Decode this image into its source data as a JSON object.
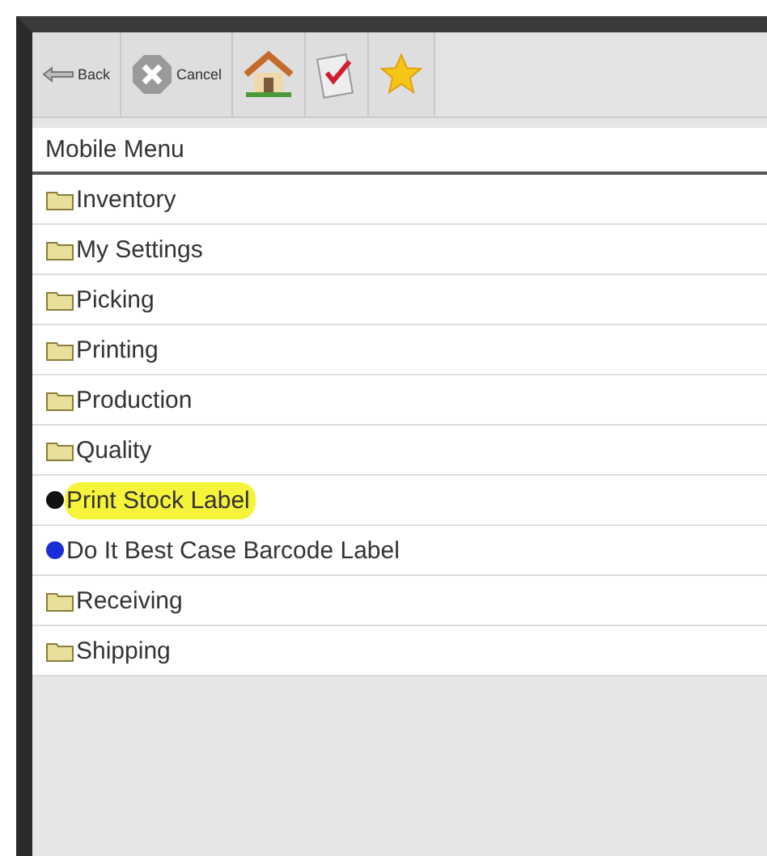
{
  "toolbar": [
    {
      "kind": "back",
      "label": "Back"
    },
    {
      "kind": "cancel",
      "label": "Cancel"
    },
    {
      "kind": "home"
    },
    {
      "kind": "checklist"
    },
    {
      "kind": "favorite"
    }
  ],
  "menu": {
    "title": "Mobile Menu",
    "items": [
      {
        "kind": "folder",
        "label": "Inventory",
        "highlighted": false
      },
      {
        "kind": "folder",
        "label": "My Settings",
        "highlighted": false
      },
      {
        "kind": "folder",
        "label": "Picking",
        "highlighted": false
      },
      {
        "kind": "folder",
        "label": "Printing",
        "highlighted": false
      },
      {
        "kind": "folder",
        "label": "Production",
        "highlighted": false
      },
      {
        "kind": "folder",
        "label": "Quality",
        "highlighted": false
      },
      {
        "kind": "action",
        "label": "Print Stock Label",
        "color": "#111111",
        "highlighted": true
      },
      {
        "kind": "action",
        "label": "Do It Best Case Barcode Label",
        "color": "#1a2ed8",
        "highlighted": false
      },
      {
        "kind": "folder",
        "label": "Receiving",
        "highlighted": false
      },
      {
        "kind": "folder",
        "label": "Shipping",
        "highlighted": false
      }
    ]
  }
}
